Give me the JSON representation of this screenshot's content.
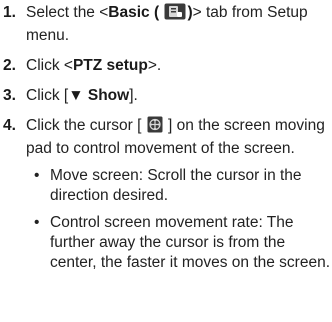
{
  "steps": [
    {
      "num": "1.",
      "pre": "Select the <",
      "bold": "Basic (",
      "bold_close": ")",
      "post": "> tab from Setup menu.",
      "icon": "basic-setup-icon"
    },
    {
      "num": "2.",
      "pre": "Click <",
      "bold": "PTZ setup",
      "post": ">."
    },
    {
      "num": "3.",
      "pre": "Click [",
      "bold": "▼ Show",
      "post": "]."
    },
    {
      "num": "4.",
      "pre": "Click the cursor [",
      "post": "] on the screen moving pad to control movement of the screen.",
      "icon": "cursor-pad-icon"
    }
  ],
  "bullets": [
    {
      "dot": "•",
      "text": "Move screen: Scroll the cursor in the direction desired."
    },
    {
      "dot": "•",
      "text": "Control screen movement rate: The further away the cursor is from the center, the faster it moves on the screen."
    }
  ],
  "colors": {
    "icon_dark": "#3a3a3a",
    "icon_light": "#d8d8d8"
  }
}
